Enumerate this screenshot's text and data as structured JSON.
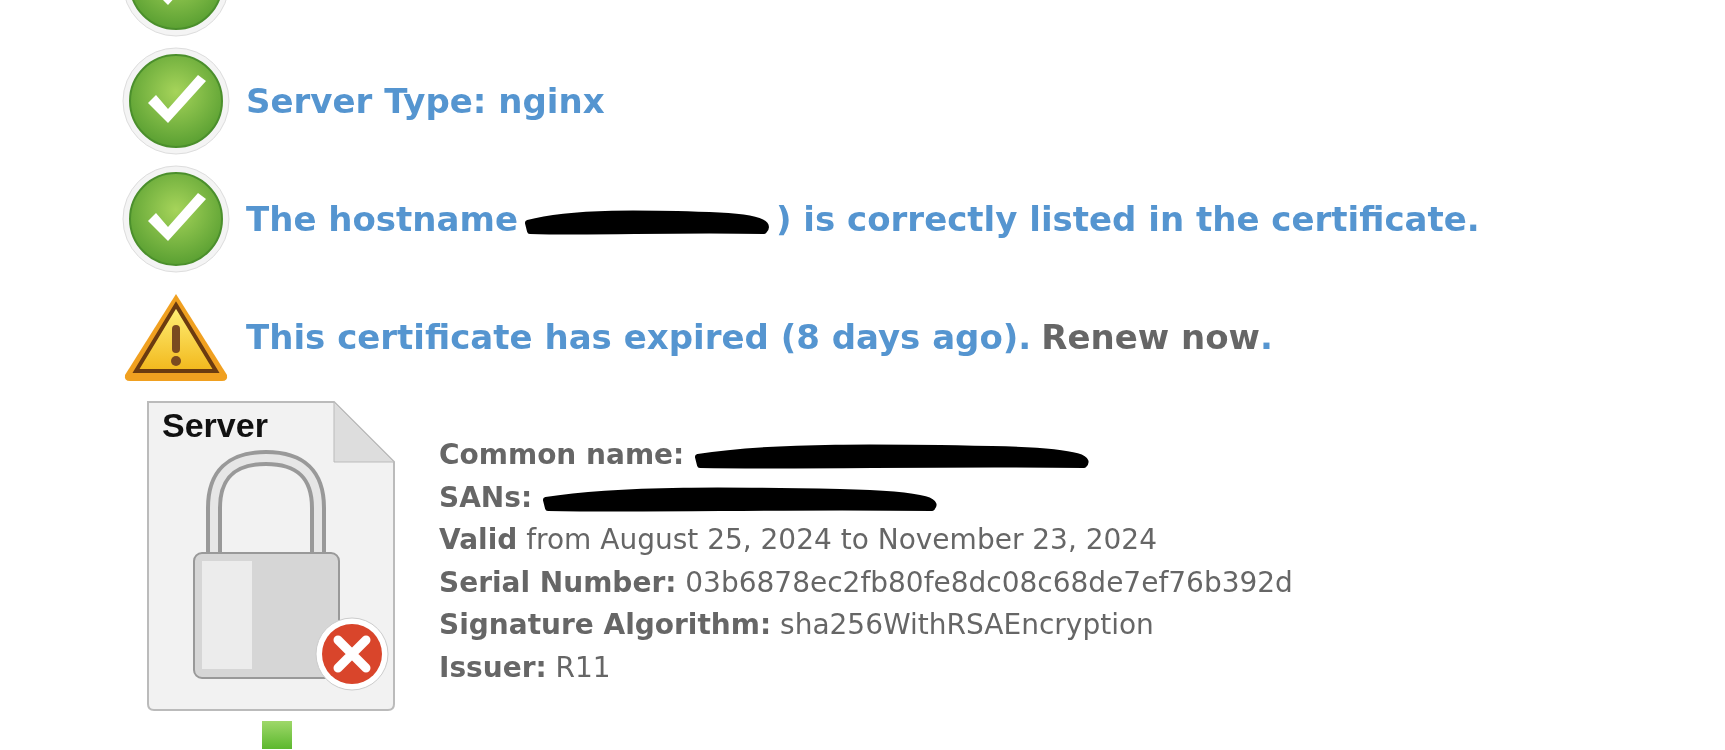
{
  "checks": [
    {
      "kind": "ok"
    },
    {
      "kind": "ok",
      "text": "Server Type: nginx"
    },
    {
      "kind": "ok",
      "text": "The hostname",
      "redacted": true,
      "after": ") is correctly listed in the certificate."
    },
    {
      "kind": "warning",
      "text": "This certificate has expired (8 days ago).",
      "link": "Renew now",
      "after": "."
    }
  ],
  "certificate": {
    "image_label": "Server",
    "fields": [
      {
        "label": "Common name:",
        "redacted": true
      },
      {
        "label": "SANs:",
        "redacted": true
      },
      {
        "label": "Valid",
        "value": "from August 25, 2024 to November 23, 2024"
      },
      {
        "label": "Serial Number:",
        "value": "03b6878ec2fb80fe8dc08c68de7ef76b392d"
      },
      {
        "label": "Signature Algorithm:",
        "value": "sha256WithRSAEncryption"
      },
      {
        "label": "Issuer:",
        "value": "R11"
      }
    ]
  }
}
